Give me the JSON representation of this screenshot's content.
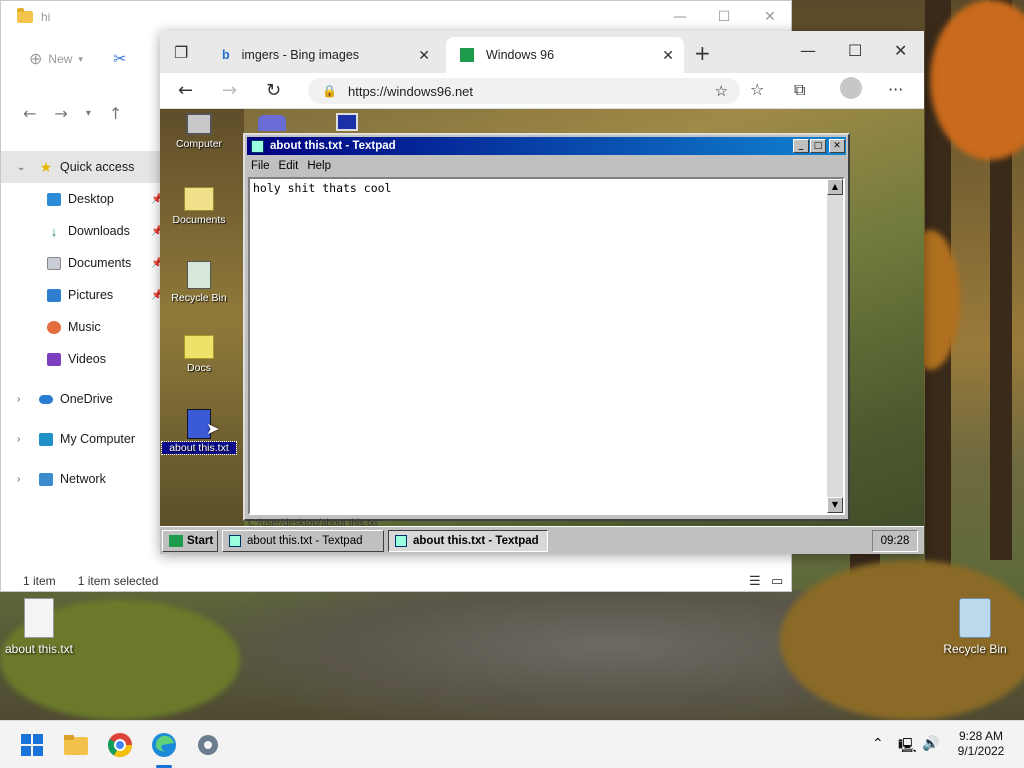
{
  "explorer": {
    "title": "hi",
    "new_label": "New",
    "nav_items": [
      {
        "label": "Quick access",
        "icon": "star-icon"
      },
      {
        "label": "Desktop",
        "icon": "desktop-icon"
      },
      {
        "label": "Downloads",
        "icon": "download-icon"
      },
      {
        "label": "Documents",
        "icon": "documents-icon"
      },
      {
        "label": "Pictures",
        "icon": "pictures-icon"
      },
      {
        "label": "Music",
        "icon": "music-icon"
      },
      {
        "label": "Videos",
        "icon": "videos-icon"
      },
      {
        "label": "OneDrive",
        "icon": "cloud-icon"
      },
      {
        "label": "My Computer",
        "icon": "computer-icon"
      },
      {
        "label": "Network",
        "icon": "network-icon"
      }
    ],
    "status": {
      "count": "1 item",
      "selected": "1 item selected"
    }
  },
  "edge": {
    "tabs": [
      {
        "label": "imgers - Bing images",
        "icon": "bing-icon"
      },
      {
        "label": "Windows 96",
        "icon": "windows96-icon"
      }
    ],
    "url": "https://windows96.net"
  },
  "win96": {
    "desktop_icons": [
      {
        "label": "Computer"
      },
      {
        "label": "Documents"
      },
      {
        "label": "Recycle Bin"
      },
      {
        "label": "Docs"
      },
      {
        "label": "about this.txt"
      }
    ],
    "textpad": {
      "title": "about this.txt - Textpad",
      "menu": [
        "File",
        "Edit",
        "Help"
      ],
      "content": "holy shit thats cool",
      "status_path": "C:/user/desktop/about this.txt"
    },
    "taskbar": {
      "start_label": "Start",
      "buttons": [
        "about this.txt - Textpad",
        "about this.txt - Textpad"
      ],
      "clock": "09:28"
    }
  },
  "desktop": {
    "icons": [
      {
        "label": "about this.txt"
      },
      {
        "label": "Recycle Bin"
      }
    ]
  },
  "taskbar": {
    "apps": [
      "start-icon",
      "file-explorer-icon",
      "chrome-icon",
      "edge-icon",
      "settings-icon"
    ],
    "time": "9:28 AM",
    "date": "9/1/2022"
  }
}
